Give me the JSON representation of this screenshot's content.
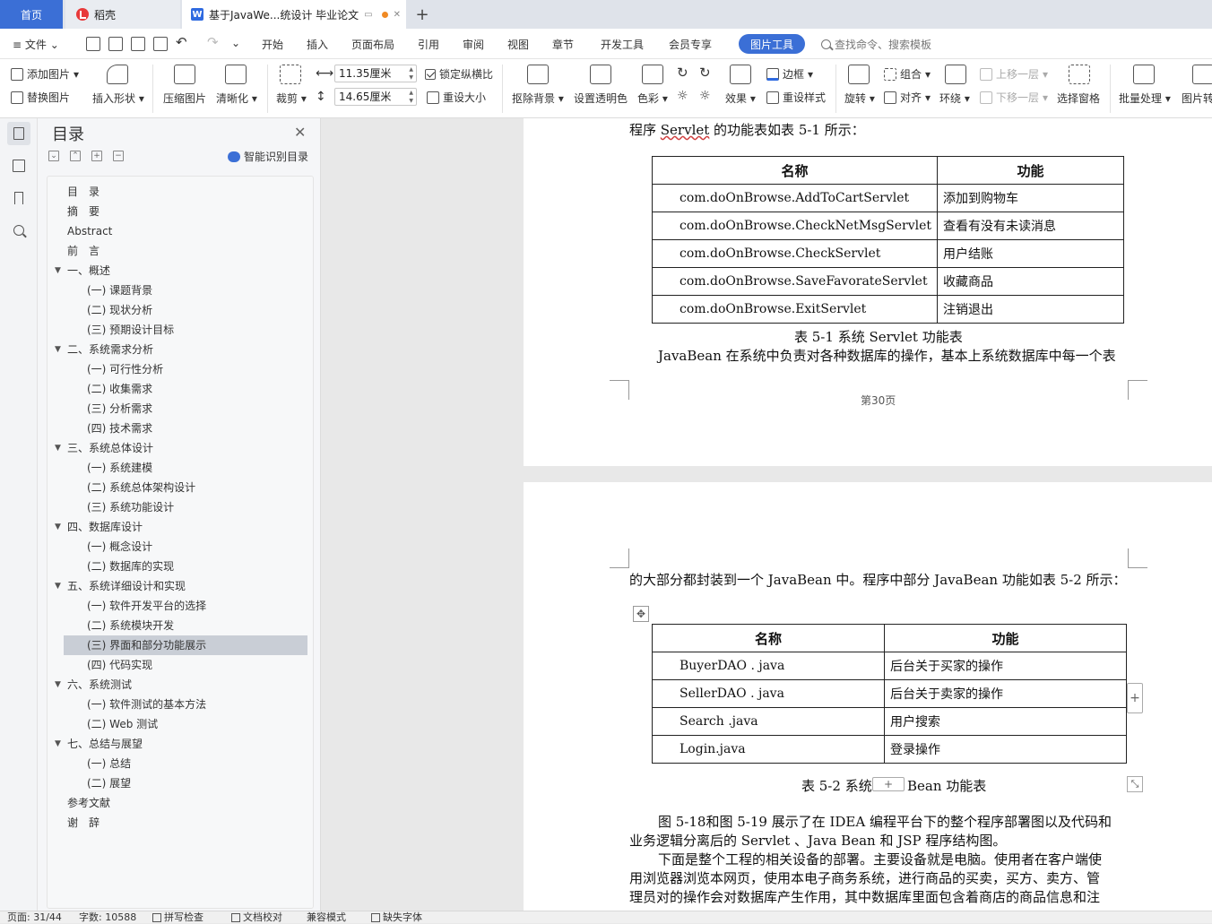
{
  "tabs": {
    "home": "首页",
    "daoke": "稻壳",
    "doc": "基于JavaWe...统设计 毕业论文",
    "add": "+"
  },
  "menu": {
    "file": "文件",
    "items": [
      "开始",
      "插入",
      "页面布局",
      "引用",
      "审阅",
      "视图",
      "章节",
      "开发工具",
      "会员专享"
    ],
    "active": "图片工具",
    "search_placeholder": "查找命令、搜索模板"
  },
  "ribbon": {
    "add_picture": "添加图片",
    "replace_picture": "替换图片",
    "insert_shape": "插入形状",
    "compress": "压缩图片",
    "clarity": "清晰化",
    "crop": "裁剪",
    "width": "11.35厘米",
    "height": "14.65厘米",
    "lock_ratio": "锁定纵横比",
    "reset_size": "重设大小",
    "remove_bg": "抠除背景",
    "set_transparent": "设置透明色",
    "color": "色彩",
    "effect": "效果",
    "border": "边框",
    "reset_style": "重设样式",
    "rotate": "旋转",
    "group": "组合",
    "align": "对齐",
    "wrap": "环绕",
    "bring_forward": "上移一层",
    "send_backward": "下移一层",
    "selection_pane": "选择窗格",
    "batch": "批量处理",
    "picture_convert": "图片转"
  },
  "toc": {
    "title": "目录",
    "smart": "智能识别目录",
    "items": [
      {
        "text": "目　录",
        "level": 0
      },
      {
        "text": "摘　要",
        "level": 0
      },
      {
        "text": "Abstract",
        "level": 0
      },
      {
        "text": "前　言",
        "level": 0
      },
      {
        "text": "一、概述",
        "level": 0,
        "caret": true
      },
      {
        "text": "(一) 课题背景",
        "level": 1
      },
      {
        "text": "(二) 现状分析",
        "level": 1
      },
      {
        "text": "(三) 预期设计目标",
        "level": 1
      },
      {
        "text": "二、系统需求分析",
        "level": 0,
        "caret": true
      },
      {
        "text": "(一) 可行性分析",
        "level": 1
      },
      {
        "text": "(二) 收集需求",
        "level": 1
      },
      {
        "text": "(三) 分析需求",
        "level": 1
      },
      {
        "text": "(四) 技术需求",
        "level": 1
      },
      {
        "text": "三、系统总体设计",
        "level": 0,
        "caret": true
      },
      {
        "text": "(一) 系统建模",
        "level": 1
      },
      {
        "text": "(二) 系统总体架构设计",
        "level": 1
      },
      {
        "text": "(三) 系统功能设计",
        "level": 1
      },
      {
        "text": "四、数据库设计",
        "level": 0,
        "caret": true
      },
      {
        "text": "(一) 概念设计",
        "level": 1
      },
      {
        "text": "(二) 数据库的实现",
        "level": 1
      },
      {
        "text": "五、系统详细设计和实现",
        "level": 0,
        "caret": true
      },
      {
        "text": "(一) 软件开发平台的选择",
        "level": 1
      },
      {
        "text": "(二) 系统模块开发",
        "level": 1
      },
      {
        "text": "(三) 界面和部分功能展示",
        "level": 1,
        "selected": true
      },
      {
        "text": "(四) 代码实现",
        "level": 1
      },
      {
        "text": "六、系统测试",
        "level": 0,
        "caret": true
      },
      {
        "text": "(一) 软件测试的基本方法",
        "level": 1
      },
      {
        "text": "(二) Web 测试",
        "level": 1
      },
      {
        "text": "七、总结与展望",
        "level": 0,
        "caret": true
      },
      {
        "text": "(一) 总结",
        "level": 1
      },
      {
        "text": "(二) 展望",
        "level": 1
      },
      {
        "text": "参考文献",
        "level": 0
      },
      {
        "text": "谢　辞",
        "level": 0
      }
    ]
  },
  "page1": {
    "intro_prefix": "程序 ",
    "intro_kw": "Servlet",
    "intro_suffix": " 的功能表如表 5-1 所示：",
    "table_headers": [
      "名称",
      "功能"
    ],
    "table_rows": [
      [
        "com.doOnBrowse.AddToCartServlet",
        "添加到购物车"
      ],
      [
        "com.doOnBrowse.CheckNetMsgServlet",
        "查看有没有未读消息"
      ],
      [
        "com.doOnBrowse.CheckServlet",
        "用户结账"
      ],
      [
        "com.doOnBrowse.SaveFavorateServlet",
        "收藏商品"
      ],
      [
        "com.doOnBrowse.ExitServlet",
        "注销退出"
      ]
    ],
    "caption": "表 5-1  系统 Servlet  功能表",
    "para": "JavaBean 在系统中负责对各种数据库的操作，基本上系统数据库中每一个表",
    "page_number": "第30页"
  },
  "page2": {
    "intro": "的大部分都封装到一个 JavaBean 中。程序中部分 JavaBean 功能如表 5-2 所示：",
    "table_headers": [
      "名称",
      "功能"
    ],
    "table_rows": [
      [
        "BuyerDAO . java",
        "后台关于买家的操作"
      ],
      [
        "SellerDAO . java",
        "后台关于卖家的操作"
      ],
      [
        "Search .java",
        "用户搜索"
      ],
      [
        "Login.java",
        "登录操作"
      ]
    ],
    "caption_left": "表 5-2  系统",
    "caption_right": "Bean 功能表",
    "para1_l1": "图 5-18和图 5-19  展示了在 IDEA 编程平台下的整个程序部署图以及代码和",
    "para1_l2": "业务逻辑分离后的 Servlet 、Java Bean 和 JSP 程序结构图。",
    "para2_l1": "下面是整个工程的相关设备的部署。主要设备就是电脑。使用者在客户端使",
    "para2_l2": "用浏览器浏览本网页，使用本电子商务系统，进行商品的买卖，买方、卖方、管",
    "para2_l3": "理员对的操作会对数据库产生作用，其中数据库里面包含着商店的商品信息和注"
  },
  "status": {
    "page": "页面: 31/44",
    "words": "字数: 10588",
    "spell": "拼写检查",
    "proof": "文档校对",
    "compat": "兼容模式",
    "font_missing": "缺失字体"
  }
}
